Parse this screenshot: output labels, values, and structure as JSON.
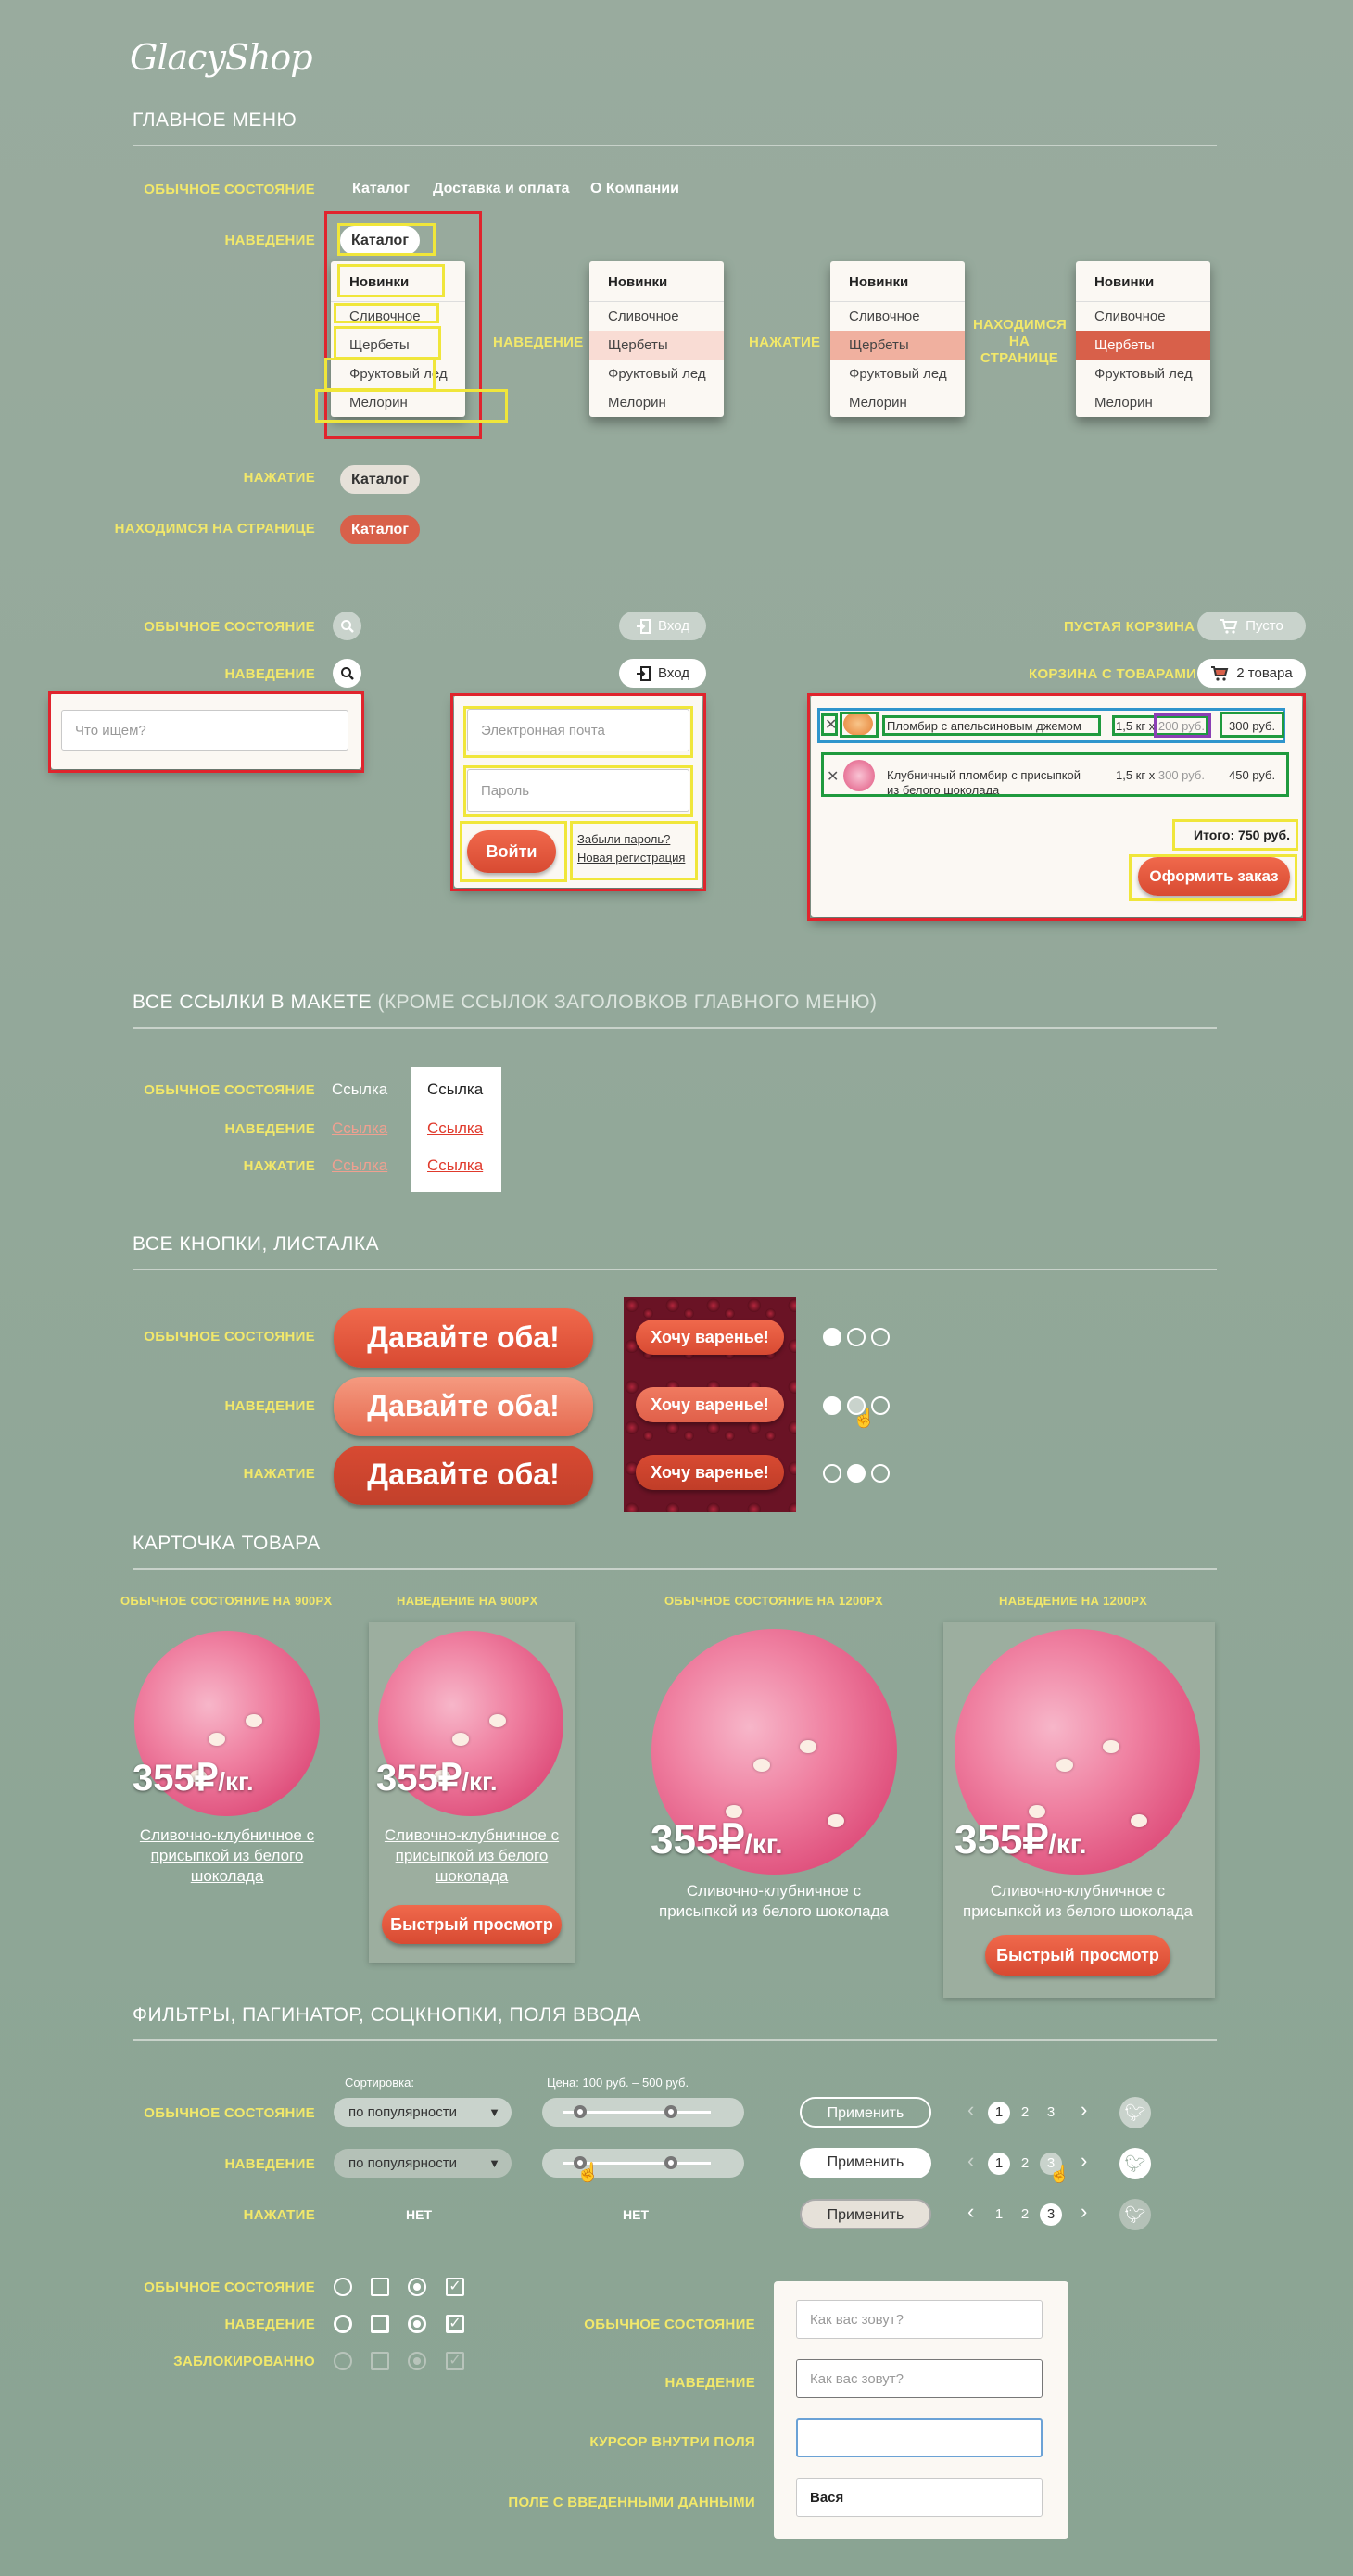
{
  "logo": "GlacyShop",
  "sections": {
    "main_menu": "ГЛАВНОЕ МЕНЮ",
    "links": "ВСЕ ССЫЛКИ В МАКЕТЕ",
    "links_note": "(КРОМЕ ССЫЛОК ЗАГОЛОВКОВ ГЛАВНОГО МЕНЮ)",
    "buttons": "ВСЕ КНОПКИ, ЛИСТАЛКА",
    "card": "КАРТОЧКА ТОВАРА",
    "filters": "ФИЛЬТРЫ, ПАГИНАТОР, СОЦКНОПКИ, ПОЛЯ ВВОДА"
  },
  "states": {
    "normal": "ОБЫЧНОЕ СОСТОЯНИЕ",
    "hover": "НАВЕДЕНИЕ",
    "press": "НАЖАТИЕ",
    "on_page": "НАХОДИМСЯ НА СТРАНИЦЕ",
    "on_page_wrap": "НАХОДИМСЯ НА СТРАНИЦЕ",
    "empty_cart": "ПУСТАЯ КОРЗИНА",
    "cart_with_items": "КОРЗИНА С ТОВАРАМИ",
    "disabled": "ЗАБЛОКИРОВАННО",
    "cursor_inside": "КУРСОР ВНУТРИ ПОЛЯ",
    "filled": "ПОЛЕ С ВВЕДЕННЫМИ ДАННЫМИ",
    "normal_900": "ОБЫЧНОЕ СОСТОЯНИЕ НА 900PX",
    "hover_900": "НАВЕДЕНИЕ НА 900PX",
    "normal_1200": "ОБЫЧНОЕ СОСТОЯНИЕ НА 1200PX",
    "hover_1200": "НАВЕДЕНИЕ НА 1200PX",
    "none": "НЕТ"
  },
  "nav": {
    "catalog": "Каталог",
    "delivery": "Доставка и оплата",
    "about": "О Компании"
  },
  "dropdown": [
    "Новинки",
    "Сливочное",
    "Щербеты",
    "Фруктовый лед",
    "Мелорин"
  ],
  "search": {
    "placeholder": "Что ищем?"
  },
  "login": {
    "label": "Вход",
    "email": "Электронная почта",
    "password": "Пароль",
    "submit": "Войти",
    "forgot": "Забыли пароль?",
    "register": "Новая регистрация"
  },
  "cart": {
    "empty": "Пусто",
    "items_count": "2 товара",
    "items": [
      {
        "name": "Пломбир с апельсиновым джемом",
        "qty": "1,5 кг х",
        "unit": "200 руб.",
        "total": "300 руб."
      },
      {
        "name": "Клубничный пломбир с присыпкой из белого шоколада",
        "qty": "1,5 кг х",
        "unit": "300 руб.",
        "total": "450 руб."
      }
    ],
    "sum": "Итого: 750 руб.",
    "order": "Оформить заказ",
    "remove": "✕"
  },
  "link_text": "Ссылка",
  "big_button": "Давайте оба!",
  "slide_button": "Хочу варенье!",
  "product": {
    "price": "355₽",
    "unit": "/кг.",
    "name": "Сливочно-клубничное с присыпкой из белого шоколада",
    "quick": "Быстрый просмотр"
  },
  "filters": {
    "sort_label": "Сортировка:",
    "sort_value": "по популярности",
    "price_label": "Цена: 100 руб. – 500 руб.",
    "apply": "Применить",
    "pages": [
      "1",
      "2",
      "3"
    ],
    "prev": "‹",
    "next": "›"
  },
  "form": {
    "placeholder": "Как вас зовут?",
    "filled": "Вася"
  },
  "colors": {
    "accent": "#e2553b",
    "label_yellow": "#f2e86a",
    "bg": "#90a898"
  }
}
